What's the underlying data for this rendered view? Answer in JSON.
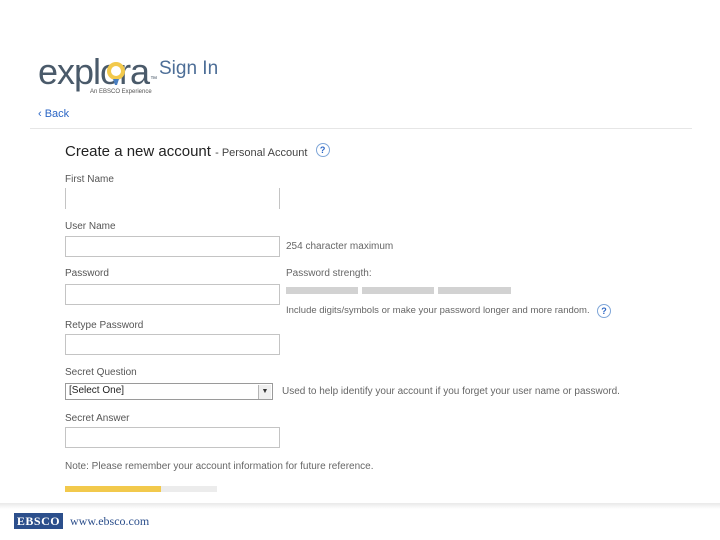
{
  "header": {
    "logo_text": "explora",
    "logo_tagline": "An EBSCO Experience",
    "logo_tm": "™",
    "title": "Sign In",
    "back_label": "‹ Back"
  },
  "form": {
    "title": "Create a new account",
    "subtitle": "- Personal Account",
    "help_glyph": "?",
    "first_name_label": "First Name",
    "user_name_label": "User Name",
    "user_name_hint": "254 character maximum",
    "password_label": "Password",
    "password_strength_label": "Password strength:",
    "password_strength_level": 0,
    "password_hint": "Include digits/symbols or make your password longer and more random.",
    "retype_password_label": "Retype Password",
    "secret_question_label": "Secret Question",
    "secret_question_value": "[Select One]",
    "secret_question_hint": "Used to help identify your account if you forget your user name or password.",
    "secret_answer_label": "Secret Answer",
    "note": "Note: Please remember your account information for future reference.",
    "progress_fraction": 0.63
  },
  "footer": {
    "brand": "EBSCO",
    "url": "www.ebsco.com"
  },
  "colors": {
    "accent_blue": "#2b66c5",
    "title_blue": "#4d6e97",
    "ebsco_navy": "#2c4f8c",
    "progress_yellow": "#f2c94c"
  }
}
